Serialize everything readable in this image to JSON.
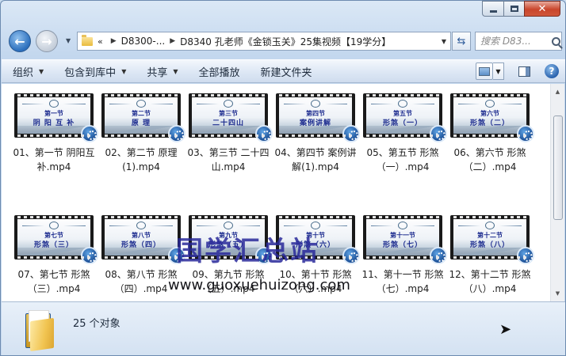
{
  "window": {
    "caption": {
      "minimize": "minimize",
      "maximize": "maximize",
      "close": "✕"
    }
  },
  "nav": {
    "back_icon": "back-arrow-icon",
    "forward_icon": "forward-arrow-icon",
    "breadcrumbs": [
      "«",
      "D8300-...",
      "D8340 孔老师《金锁玉关》25集视频【19学分】"
    ],
    "search_placeholder": "搜索 D83..."
  },
  "toolbar": {
    "organize": "组织",
    "include_library": "包含到库中",
    "share": "共享",
    "play_all": "全部播放",
    "new_folder": "新建文件夹"
  },
  "files": [
    {
      "name": "01、第一节 阴阳互补.mp4",
      "frame_line1": "第一节",
      "frame_line2": "阴 阳 互 补"
    },
    {
      "name": "02、第二节 原理(1).mp4",
      "frame_line1": "第二节",
      "frame_line2": "原   理"
    },
    {
      "name": "03、第三节 二十四山.mp4",
      "frame_line1": "第三节",
      "frame_line2": "二十四山"
    },
    {
      "name": "04、第四节 案例讲解(1).mp4",
      "frame_line1": "第四节",
      "frame_line2": "案例讲解"
    },
    {
      "name": "05、第五节 形煞（一）.mp4",
      "frame_line1": "第五节",
      "frame_line2": "形煞（一）"
    },
    {
      "name": "06、第六节 形煞（二）.mp4",
      "frame_line1": "第六节",
      "frame_line2": "形煞（二）"
    },
    {
      "name": "07、第七节 形煞（三）.mp4",
      "frame_line1": "第七节",
      "frame_line2": "形煞（三）"
    },
    {
      "name": "08、第八节 形煞（四）.mp4",
      "frame_line1": "第八节",
      "frame_line2": "形煞（四）"
    },
    {
      "name": "09、第九节 形煞（五）.mp4",
      "frame_line1": "第九节",
      "frame_line2": "形煞（五）"
    },
    {
      "name": "10、第十节 形煞（六）.mp4",
      "frame_line1": "第十节",
      "frame_line2": "形煞（六）"
    },
    {
      "name": "11、第十一节 形煞（七）.mp4",
      "frame_line1": "第十一节",
      "frame_line2": "形煞（七）"
    },
    {
      "name": "12、第十二节 形煞（八）.mp4",
      "frame_line1": "第十二节",
      "frame_line2": "形煞（八）"
    }
  ],
  "watermark": {
    "title": "国学汇总站",
    "url": "www.guoxuehuizong.com"
  },
  "details": {
    "count_text": "25 个对象"
  }
}
